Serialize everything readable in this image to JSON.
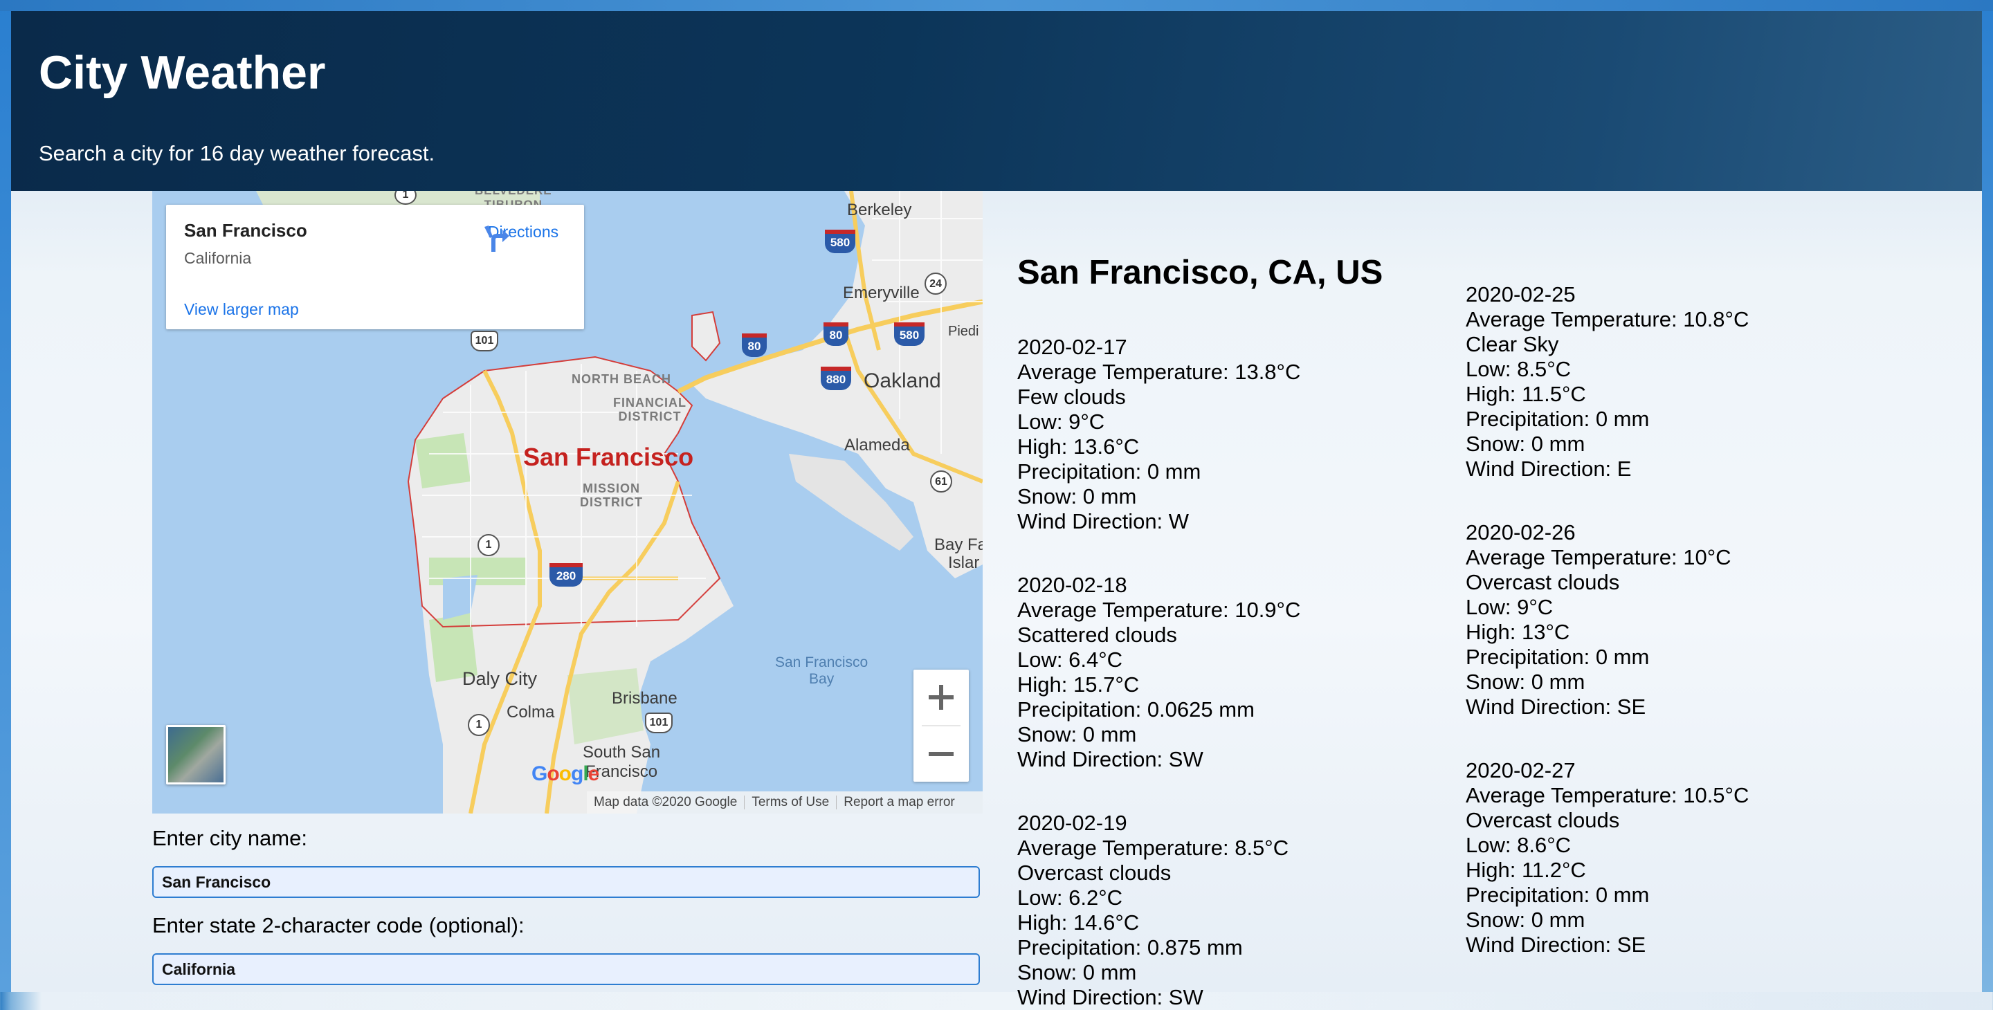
{
  "header": {
    "title": "City Weather",
    "subtitle": "Search a city for 16 day weather forecast."
  },
  "map": {
    "place_card": {
      "name": "San Francisco",
      "region": "California",
      "directions_label": "Directions",
      "view_larger_label": "View larger map"
    },
    "labels": {
      "berkeley": "Berkeley",
      "emeryville": "Emeryville",
      "oakland": "Oakland",
      "alameda": "Alameda",
      "piedmont": "Piedi",
      "bay_farm": "Bay Fa",
      "bay_farm_2": "Islar",
      "north_beach": "NORTH BEACH",
      "financial_district": "FINANCIAL\nDISTRICT",
      "mission_district": "MISSION\nDISTRICT",
      "san_francisco": "San Francisco",
      "daly_city": "Daly City",
      "colma": "Colma",
      "brisbane": "Brisbane",
      "south_san_francisco": "South San\nFrancisco",
      "sf_bay": "San Francisco\nBay",
      "belvedere": "BELVEDERE\nTIBURON"
    },
    "shields": {
      "i580": "580",
      "i80": "80",
      "i880": "880",
      "i280": "280",
      "r24": "24",
      "r61": "61",
      "us101": "101",
      "r1": "1"
    },
    "google_logo": "Google",
    "footer": {
      "map_data": "Map data ©2020 Google",
      "terms": "Terms of Use",
      "report": "Report a map error"
    },
    "zoom_in_label": "+",
    "zoom_out_label": "−"
  },
  "form": {
    "city_label": "Enter city name:",
    "city_value": "San Francisco",
    "state_label": "Enter state 2-character code (optional):",
    "state_value": "California"
  },
  "forecast": {
    "location": "San Francisco, CA, US",
    "days": [
      {
        "date": "2020-02-17",
        "avg_temp": "Average Temperature: 13.8°C",
        "description": "Few clouds",
        "low": "Low: 9°C",
        "high": "High: 13.6°C",
        "precipitation": "Precipitation: 0 mm",
        "snow": "Snow: 0 mm",
        "wind": "Wind Direction: W"
      },
      {
        "date": "2020-02-18",
        "avg_temp": "Average Temperature: 10.9°C",
        "description": "Scattered clouds",
        "low": "Low: 6.4°C",
        "high": "High: 15.7°C",
        "precipitation": "Precipitation: 0.0625 mm",
        "snow": "Snow: 0 mm",
        "wind": "Wind Direction: SW"
      },
      {
        "date": "2020-02-19",
        "avg_temp": "Average Temperature: 8.5°C",
        "description": "Overcast clouds",
        "low": "Low: 6.2°C",
        "high": "High: 14.6°C",
        "precipitation": "Precipitation: 0.875 mm",
        "snow": "Snow: 0 mm",
        "wind": "Wind Direction: SW"
      },
      {
        "date": "2020-02-25",
        "avg_temp": "Average Temperature: 10.8°C",
        "description": "Clear Sky",
        "low": "Low: 8.5°C",
        "high": "High: 11.5°C",
        "precipitation": "Precipitation: 0 mm",
        "snow": "Snow: 0 mm",
        "wind": "Wind Direction: E"
      },
      {
        "date": "2020-02-26",
        "avg_temp": "Average Temperature: 10°C",
        "description": "Overcast clouds",
        "low": "Low: 9°C",
        "high": "High: 13°C",
        "precipitation": "Precipitation: 0 mm",
        "snow": "Snow: 0 mm",
        "wind": "Wind Direction: SE"
      },
      {
        "date": "2020-02-27",
        "avg_temp": "Average Temperature: 10.5°C",
        "description": "Overcast clouds",
        "low": "Low: 8.6°C",
        "high": "High: 11.2°C",
        "precipitation": "Precipitation: 0 mm",
        "snow": "Snow: 0 mm",
        "wind": "Wind Direction: SE"
      }
    ]
  },
  "colors": {
    "header_bg": "#0c3559",
    "link_blue": "#1a73e8",
    "sf_label_red": "#c5221f",
    "water": "#a9cdef",
    "input_border": "#2e7dd1"
  }
}
